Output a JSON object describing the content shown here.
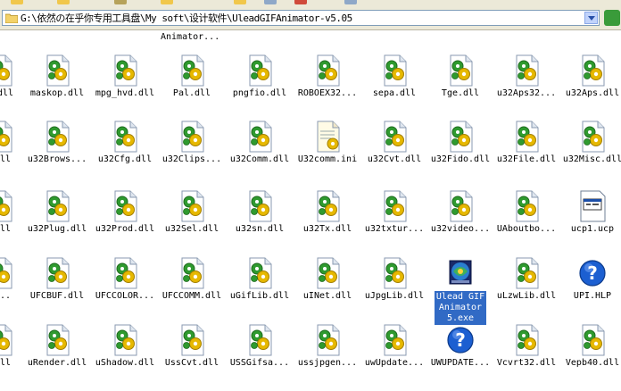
{
  "address": {
    "path": "G:\\依然の在乎你专用工具盘\\My soft\\设计软件\\UleadGIFAnimator-v5.05"
  },
  "header_label": "Animator...",
  "rows": [
    {
      "items": [
        {
          "label": "d.dll",
          "icon": "dll-gear-icon"
        },
        {
          "label": "maskop.dll",
          "icon": "dll-gear-icon"
        },
        {
          "label": "mpg_hvd.dll",
          "icon": "dll-gear-icon"
        },
        {
          "label": "Pal.dll",
          "icon": "dll-gear-icon"
        },
        {
          "label": "pngfio.dll",
          "icon": "dll-gear-icon"
        },
        {
          "label": "ROBOEX32...",
          "icon": "dll-gear-icon"
        },
        {
          "label": "sepa.dll",
          "icon": "dll-gear-icon"
        },
        {
          "label": "Tge.dll",
          "icon": "dll-gear-icon"
        },
        {
          "label": "u32Aps32...",
          "icon": "dll-gear-icon"
        },
        {
          "label": "u32Aps.dll",
          "icon": "dll-gear-icon"
        }
      ]
    },
    {
      "items": [
        {
          "label": ".dll",
          "icon": "dll-gear-icon"
        },
        {
          "label": "u32Brows...",
          "icon": "dll-gear-icon"
        },
        {
          "label": "u32Cfg.dll",
          "icon": "dll-gear-icon"
        },
        {
          "label": "u32Clips...",
          "icon": "dll-gear-icon"
        },
        {
          "label": "u32Comm.dll",
          "icon": "dll-gear-icon"
        },
        {
          "label": "U32comm.ini",
          "icon": "ini-file-icon"
        },
        {
          "label": "u32Cvt.dll",
          "icon": "dll-gear-icon"
        },
        {
          "label": "u32Fido.dll",
          "icon": "dll-gear-icon"
        },
        {
          "label": "u32File.dll",
          "icon": "dll-gear-icon"
        },
        {
          "label": "u32Misc.dll",
          "icon": "dll-gear-icon"
        }
      ]
    },
    {
      "items": [
        {
          "label": ".dll",
          "icon": "dll-gear-icon"
        },
        {
          "label": "u32Plug.dll",
          "icon": "dll-gear-icon"
        },
        {
          "label": "u32Prod.dll",
          "icon": "dll-gear-icon"
        },
        {
          "label": "u32Sel.dll",
          "icon": "dll-gear-icon"
        },
        {
          "label": "u32sn.dll",
          "icon": "dll-gear-icon"
        },
        {
          "label": "u32Tx.dll",
          "icon": "dll-gear-icon"
        },
        {
          "label": "u32txtur...",
          "icon": "dll-gear-icon"
        },
        {
          "label": "u32video...",
          "icon": "dll-gear-icon"
        },
        {
          "label": "UAboutbo...",
          "icon": "dll-gear-icon"
        },
        {
          "label": "ucp1.ucp",
          "icon": "ucp-file-icon"
        }
      ]
    },
    {
      "items": [
        {
          "label": "O...",
          "icon": "dll-gear-icon"
        },
        {
          "label": "UFCBUF.dll",
          "icon": "dll-gear-icon"
        },
        {
          "label": "UFCCOLOR...",
          "icon": "dll-gear-icon"
        },
        {
          "label": "UFCCOMM.dll",
          "icon": "dll-gear-icon"
        },
        {
          "label": "uGifLib.dll",
          "icon": "dll-gear-icon"
        },
        {
          "label": "uINet.dll",
          "icon": "dll-gear-icon"
        },
        {
          "label": "uJpgLib.dll",
          "icon": "dll-gear-icon"
        },
        {
          "label": "Ulead GIF Animator 5.exe",
          "icon": "gif-animator-app-icon",
          "selected": true
        },
        {
          "label": "uLzwLib.dll",
          "icon": "dll-gear-icon"
        },
        {
          "label": "UPI.HLP",
          "icon": "help-file-icon"
        }
      ]
    },
    {
      "items": [
        {
          "label": ".dll",
          "icon": "dll-gear-icon"
        },
        {
          "label": "uRender.dll",
          "icon": "dll-gear-icon"
        },
        {
          "label": "uShadow.dll",
          "icon": "dll-gear-icon"
        },
        {
          "label": "UssCvt.dll",
          "icon": "dll-gear-icon"
        },
        {
          "label": "USSGifsa...",
          "icon": "dll-gear-icon"
        },
        {
          "label": "ussjpgen...",
          "icon": "dll-gear-icon"
        },
        {
          "label": "uwUpdate...",
          "icon": "dll-gear-icon"
        },
        {
          "label": "UWUPDATE...",
          "icon": "help-file-icon"
        },
        {
          "label": "Vcvrt32.dll",
          "icon": "dll-gear-icon"
        },
        {
          "label": "Vepb40.dll",
          "icon": "dll-gear-icon"
        }
      ]
    }
  ],
  "colors": {
    "chrome": "#ece9d8",
    "selection": "#316ac5",
    "gear_green": "#2f9a2f",
    "gear_yellow": "#e6b800",
    "help_blue": "#1c5fd1"
  }
}
